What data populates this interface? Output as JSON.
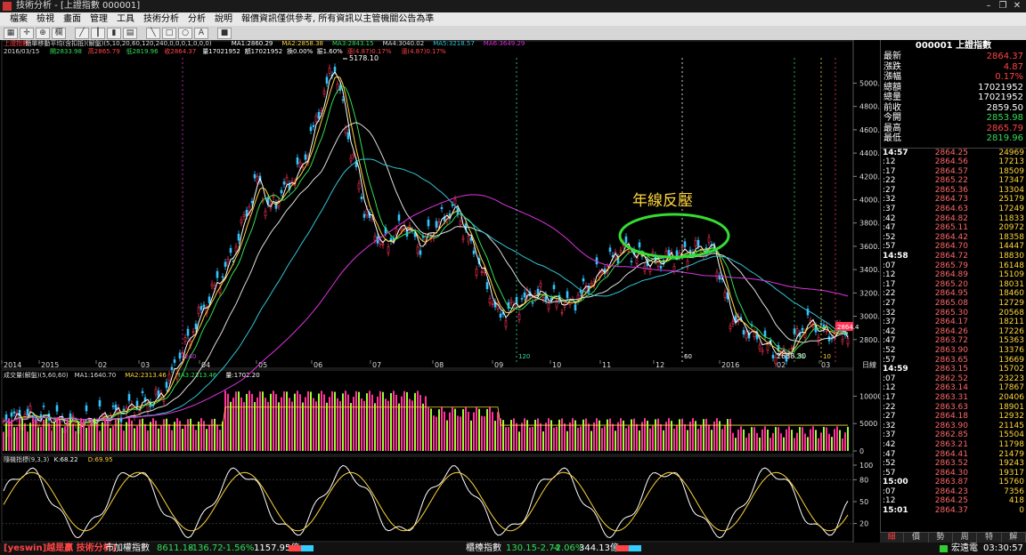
{
  "window": {
    "title": "技術分析 - [上證指數 000001]"
  },
  "menu": [
    "檔案",
    "檢視",
    "畫面",
    "管理",
    "工具",
    "技術分析",
    "分析",
    "說明",
    "報價資訊僅供參考, 所有資訊以主管機關公告為準"
  ],
  "toolbar": {
    "mode_label": "欄"
  },
  "price_panel": {
    "legend1": [
      {
        "t": "上證指數",
        "c": "#ff4444"
      },
      {
        "t": "簡單移動平均(含扣抵)(解盤)(5,10,20,60,120,240,0,0,0,1,0,0,0)",
        "c": "#dddddd"
      },
      {
        "t": "MA1:2860.29",
        "c": "#ffffff"
      },
      {
        "t": "MA2:2858.38",
        "c": "#ffd43a"
      },
      {
        "t": "MA3:2843.15",
        "c": "#33dd55"
      },
      {
        "t": "MA4:3040.02",
        "c": "#dddddd"
      },
      {
        "t": "MA5:3218.57",
        "c": "#33c4d4"
      },
      {
        "t": "MA6:3649.29",
        "c": "#dd33dd"
      }
    ],
    "legend2": [
      {
        "t": "2016/03/15",
        "c": "#dddddd"
      },
      {
        "t": "開2833.98",
        "c": "#33dd55"
      },
      {
        "t": "高2865.79",
        "c": "#ff4444"
      },
      {
        "t": "低2819.96",
        "c": "#33dd55"
      },
      {
        "t": "收2864.37",
        "c": "#ff4444"
      },
      {
        "t": "量17021952",
        "c": "#ffffff"
      },
      {
        "t": "額17021952",
        "c": "#ffffff"
      },
      {
        "t": "換0.00%",
        "c": "#ffffff"
      },
      {
        "t": "振1.60%",
        "c": "#ffffff"
      },
      {
        "t": "漲(4.87)0.17%",
        "c": "#ff4444"
      },
      {
        "t": "漲(4.87)0.17%",
        "c": "#ff4444"
      }
    ],
    "y_ticks": [
      "5000.0",
      "4800.0",
      "4600.0",
      "4400.0",
      "4200.0",
      "4000.0",
      "3800.0",
      "3600.0",
      "3400.0",
      "3200.0",
      "3000.0",
      "2800.0"
    ],
    "x_ticks": [
      "2014",
      "2015",
      "02",
      "03",
      "04",
      "05",
      "06",
      "07",
      "08",
      "09",
      "10",
      "11",
      "12",
      "2016",
      "02",
      "03"
    ],
    "x_unit": "日線",
    "high_label": "5178.10",
    "low_label": "2638.30",
    "last_price": "2864.4",
    "counters": [
      "240",
      "120",
      "60",
      "20",
      "10"
    ],
    "annotation": "年線反壓"
  },
  "volume_panel": {
    "legend": [
      {
        "t": "成交量(解盤)(5,60,60)",
        "c": "#dddddd"
      },
      {
        "t": "MA1:1640.70",
        "c": "#dddddd"
      },
      {
        "t": "MA2:2313.46",
        "c": "#ffd43a"
      },
      {
        "t": "MA3:2313.46",
        "c": "#33dd55"
      },
      {
        "t": "量:1702.20",
        "c": "#ffffff"
      }
    ],
    "y_ticks": [
      "10000",
      "5000",
      "0"
    ]
  },
  "kd_panel": {
    "legend": [
      {
        "t": "隨機指標(9,3,3)",
        "c": "#dddddd"
      },
      {
        "t": "K:68.22",
        "c": "#ffffff"
      },
      {
        "t": "D:69.95",
        "c": "#ffd43a"
      }
    ],
    "y_ticks": [
      "100",
      "80",
      "50",
      "20"
    ]
  },
  "quote": {
    "header": "000001 上證指數",
    "rows": [
      {
        "l": "最新",
        "v": "2864.37",
        "c": "#ff4444"
      },
      {
        "l": "漲跌",
        "v": "4.87",
        "c": "#ff4444"
      },
      {
        "l": "漲幅",
        "v": "0.17%",
        "c": "#ff4444"
      },
      {
        "l": "總額",
        "v": "17021952",
        "c": "#ffffff"
      },
      {
        "l": "總量",
        "v": "17021952",
        "c": "#ffffff"
      },
      {
        "l": "前收",
        "v": "2859.50",
        "c": "#ffffff"
      },
      {
        "l": "今開",
        "v": "2853.98",
        "c": "#33dd55"
      },
      {
        "l": "最高",
        "v": "2865.79",
        "c": "#ff4444"
      },
      {
        "l": "最低",
        "v": "2819.96",
        "c": "#33dd55"
      }
    ],
    "ticks": [
      {
        "t": "14:57",
        "p": "2864.25",
        "v": "24969"
      },
      {
        "t": ":12",
        "p": "2864.56",
        "v": "17213"
      },
      {
        "t": ":17",
        "p": "2864.57",
        "v": "18509"
      },
      {
        "t": ":22",
        "p": "2865.22",
        "v": "17347"
      },
      {
        "t": ":27",
        "p": "2865.36",
        "v": "13304"
      },
      {
        "t": ":32",
        "p": "2864.73",
        "v": "25179"
      },
      {
        "t": ":37",
        "p": "2864.63",
        "v": "17249"
      },
      {
        "t": ":42",
        "p": "2864.82",
        "v": "11833"
      },
      {
        "t": ":47",
        "p": "2865.11",
        "v": "20972"
      },
      {
        "t": ":52",
        "p": "2864.42",
        "v": "18358"
      },
      {
        "t": ":57",
        "p": "2864.70",
        "v": "14447"
      },
      {
        "t": "14:58",
        "p": "2864.72",
        "v": "18830"
      },
      {
        "t": ":07",
        "p": "2865.79",
        "v": "16148"
      },
      {
        "t": ":12",
        "p": "2864.89",
        "v": "15109"
      },
      {
        "t": ":17",
        "p": "2865.20",
        "v": "18031"
      },
      {
        "t": ":22",
        "p": "2864.95",
        "v": "18460"
      },
      {
        "t": ":27",
        "p": "2865.08",
        "v": "12729"
      },
      {
        "t": ":32",
        "p": "2865.30",
        "v": "20568"
      },
      {
        "t": ":37",
        "p": "2864.17",
        "v": "18211"
      },
      {
        "t": ":42",
        "p": "2864.26",
        "v": "17226"
      },
      {
        "t": ":47",
        "p": "2863.72",
        "v": "15363"
      },
      {
        "t": ":52",
        "p": "2863.90",
        "v": "13376"
      },
      {
        "t": ":57",
        "p": "2863.65",
        "v": "13669"
      },
      {
        "t": "14:59",
        "p": "2863.15",
        "v": "15702"
      },
      {
        "t": ":07",
        "p": "2862.52",
        "v": "23223"
      },
      {
        "t": ":12",
        "p": "2863.14",
        "v": "17867"
      },
      {
        "t": ":17",
        "p": "2863.31",
        "v": "20406"
      },
      {
        "t": ":22",
        "p": "2863.63",
        "v": "18901"
      },
      {
        "t": ":27",
        "p": "2864.18",
        "v": "12932"
      },
      {
        "t": ":32",
        "p": "2863.90",
        "v": "21145"
      },
      {
        "t": ":37",
        "p": "2862.85",
        "v": "15504"
      },
      {
        "t": ":42",
        "p": "2863.21",
        "v": "11798"
      },
      {
        "t": ":47",
        "p": "2864.41",
        "v": "21479"
      },
      {
        "t": ":52",
        "p": "2863.52",
        "v": "19243"
      },
      {
        "t": ":57",
        "p": "2864.30",
        "v": "19317"
      },
      {
        "t": "15:00",
        "p": "2863.87",
        "v": "15760"
      },
      {
        "t": ":07",
        "p": "2864.23",
        "v": "7356"
      },
      {
        "t": ":12",
        "p": "2864.25",
        "v": "418"
      },
      {
        "t": "15:01",
        "p": "2864.37",
        "v": "0"
      }
    ],
    "tabs": [
      "細",
      "價",
      "勢",
      "周",
      "特",
      "解"
    ]
  },
  "statusbar": {
    "brand": "[yeswin]越是贏 技術分析]",
    "idx1_name": "市加權指數",
    "idx1_val": "8611.18",
    "idx1_chg": "-136.72",
    "idx1_pct": "-1.56%",
    "idx1_amt": "1157.95億",
    "idx2_name": "櫃檯指數",
    "idx2_val": "130.15",
    "idx2_chg": "-2.74",
    "idx2_pct": "-2.06%",
    "idx2_amt": "344.13億",
    "conn": "宏遠電",
    "clock": "03:30:57"
  }
}
